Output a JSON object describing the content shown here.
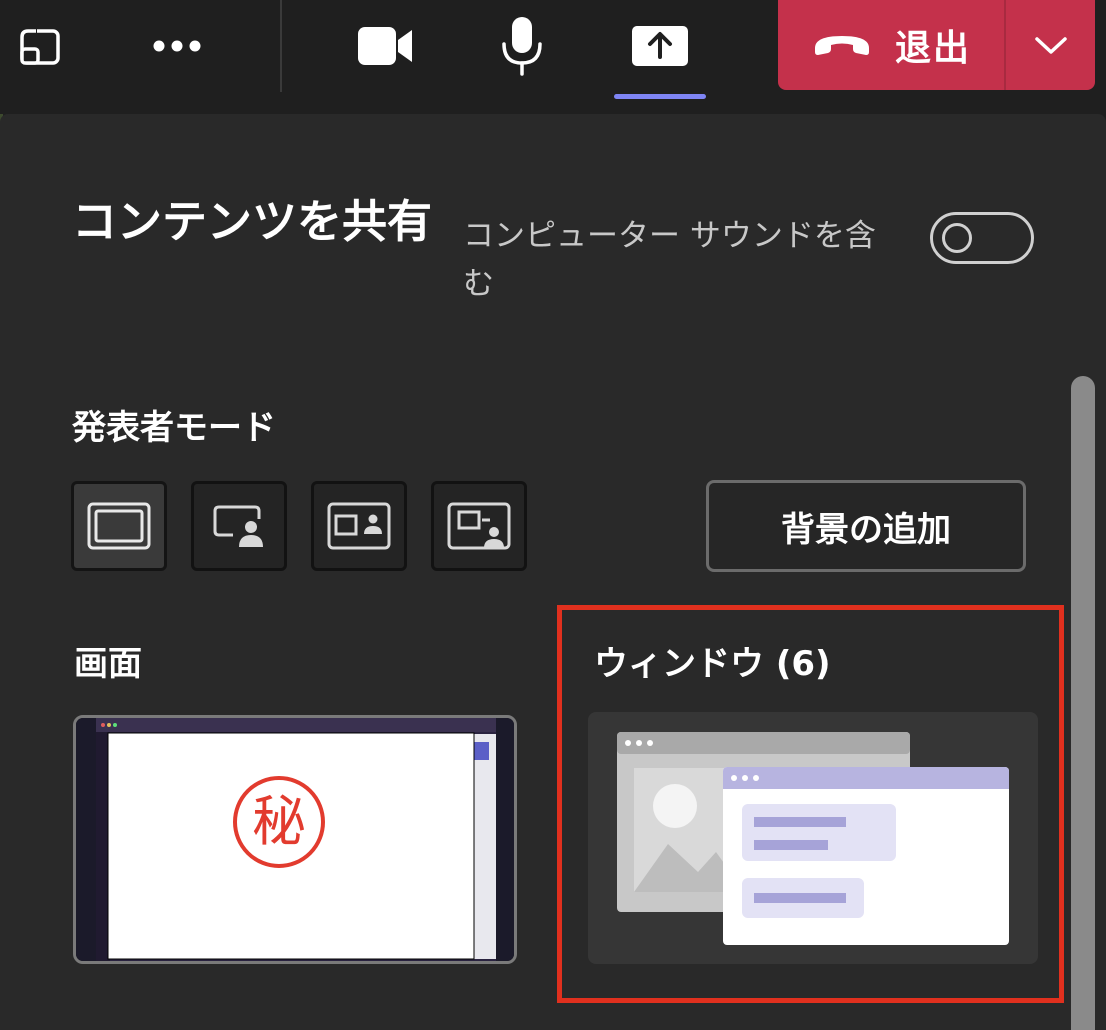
{
  "toolbar": {
    "icons": [
      "popout-icon",
      "more-icon",
      "camera-icon",
      "microphone-icon",
      "share-icon"
    ],
    "leave_label": "退出",
    "leave_color": "#c4314b",
    "share_active_color": "#7f85f5"
  },
  "panel": {
    "title": "コンテンツを共有",
    "sound_label": "コンピューター サウンドを含む",
    "sound_toggle_on": false,
    "presenter_mode_label": "発表者モード",
    "presenter_modes": [
      "content-only",
      "standout",
      "side-by-side",
      "reporter"
    ],
    "add_background_label": "背景の追加",
    "screen_label": "画面",
    "screen_stamp_text": "秘",
    "window_label": "ウィンドウ (6)",
    "highlight_color": "#e0301e"
  }
}
